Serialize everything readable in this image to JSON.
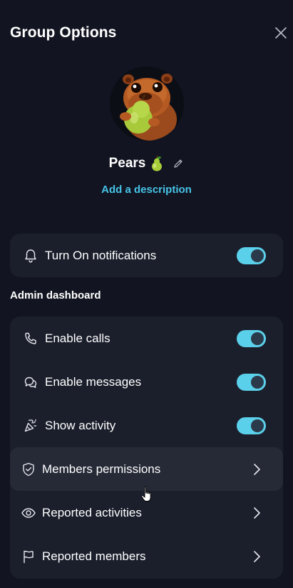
{
  "header": {
    "title": "Group Options"
  },
  "group": {
    "name": "Pears",
    "add_description": "Add a description"
  },
  "notifications": {
    "label": "Turn On notifications",
    "enabled": true
  },
  "admin": {
    "heading": "Admin dashboard",
    "items": [
      {
        "label": "Enable calls",
        "kind": "toggle",
        "enabled": true,
        "icon": "phone-icon"
      },
      {
        "label": "Enable messages",
        "kind": "toggle",
        "enabled": true,
        "icon": "chat-bubbles-icon"
      },
      {
        "label": "Show activity",
        "kind": "toggle",
        "enabled": true,
        "icon": "party-popper-icon"
      },
      {
        "label": "Members permissions",
        "kind": "link",
        "icon": "shield-check-icon"
      },
      {
        "label": "Reported activities",
        "kind": "link",
        "icon": "eye-icon"
      },
      {
        "label": "Reported members",
        "kind": "link",
        "icon": "flag-icon"
      }
    ]
  },
  "colors": {
    "background": "#121521",
    "card": "#1b1f2c",
    "row_highlight": "#262a37",
    "accent": "#47c3e8",
    "toggle_on": "#5bd0ea",
    "toggle_knob": "#2b3a4a"
  }
}
